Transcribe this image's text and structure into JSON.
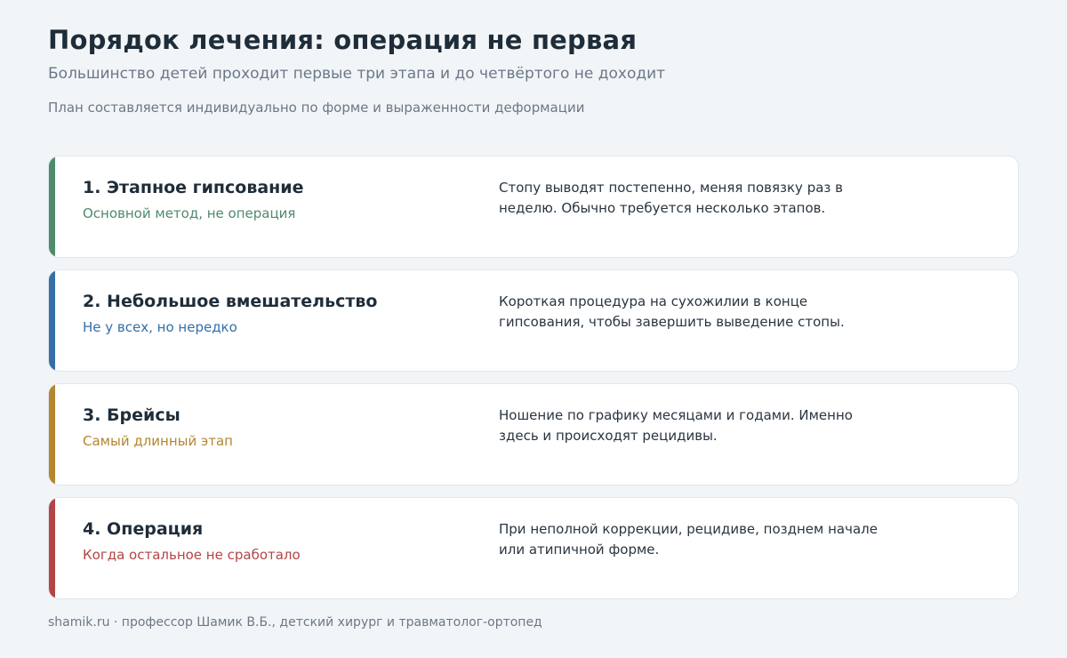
{
  "header": {
    "title": "Порядок лечения: операция не первая",
    "subtitle": "Большинство детей проходит первые три этапа и до четвёртого не доходит",
    "note": "План составляется индивидуально по форме и выраженности деформации"
  },
  "colors": {
    "step1": "#4e8a6c",
    "step2": "#356ea8",
    "step3": "#b3862f",
    "step4": "#b34545"
  },
  "steps": [
    {
      "title": "1. Этапное гипсование",
      "subtitle": "Основной метод, не операция",
      "description": "Стопу выводят постепенно, меняя повязку раз в неделю. Обычно требуется несколько этапов."
    },
    {
      "title": "2. Небольшое вмешательство",
      "subtitle": "Не у всех, но нередко",
      "description": "Короткая процедура на сухожилии в конце гипсования, чтобы завершить выведение стопы."
    },
    {
      "title": "3. Брейсы",
      "subtitle": "Самый длинный этап",
      "description": "Ношение по графику месяцами и годами. Именно здесь и происходят рецидивы."
    },
    {
      "title": "4. Операция",
      "subtitle": "Когда остальное не сработало",
      "description": "При неполной коррекции, рецидиве, позднем начале или атипичной форме."
    }
  ],
  "footer": {
    "text": "shamik.ru · профессор Шамик В.Б., детский хирург и травматолог-ортопед"
  }
}
